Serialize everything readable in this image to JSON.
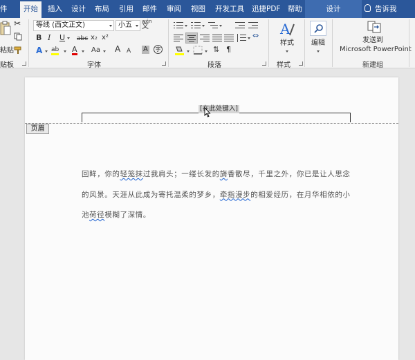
{
  "tabs": [
    "件",
    "开始",
    "插入",
    "设计",
    "布局",
    "引用",
    "邮件",
    "审阅",
    "视图",
    "开发工具",
    "迅捷PDF",
    "帮助"
  ],
  "context_tab": "设计",
  "tell_me": "告诉我",
  "ribbon": {
    "clipboard": {
      "paste_label": "粘贴",
      "group_label": "贴板"
    },
    "font": {
      "name": "等线 (西文正文)",
      "size": "小五",
      "wen_top": "wén",
      "wen_bottom": "文",
      "bold": "B",
      "italic": "I",
      "underline": "U",
      "strike": "abc",
      "subscript": "x₂",
      "superscript": "x²",
      "effects": "A",
      "highlight": "ab",
      "font_color": "A",
      "grow": "A",
      "shrink": "A",
      "aa": "Aa",
      "char_shade": "A",
      "enclosed": "字",
      "group_label": "字体"
    },
    "paragraph": {
      "group_label": "段落"
    },
    "styles": {
      "label": "样式",
      "group_label": "样式"
    },
    "editing": {
      "label": "编辑"
    },
    "new_group": {
      "line1": "发送到",
      "line2": "Microsoft PowerPoint",
      "group_label": "新建组"
    }
  },
  "colors": {
    "ribbon_blue": "#2b579a",
    "highlight_yellow": "#ffff00",
    "font_red": "#e00000",
    "spell_wavy": "#1e62d0"
  },
  "header": {
    "field_text": "[在此处键入]",
    "tag": "页眉"
  },
  "body": {
    "line1_a": "回眸，你的",
    "line1_err": "轻笼抹",
    "line1_b": "过我肩头；一缕长发的",
    "line1_c": "旖",
    "line1_d": "香散尽，千里之外，你已是让人思",
    "line2_a": "念的风景。天涯从此成为寄托温柔的梦乡，",
    "line2_err": "牵指漫步",
    "line2_b": "的相爱经历，在月华相依",
    "line3_a": "的小池",
    "line3_err": "荷径",
    "line3_b": "模糊了深情。"
  }
}
